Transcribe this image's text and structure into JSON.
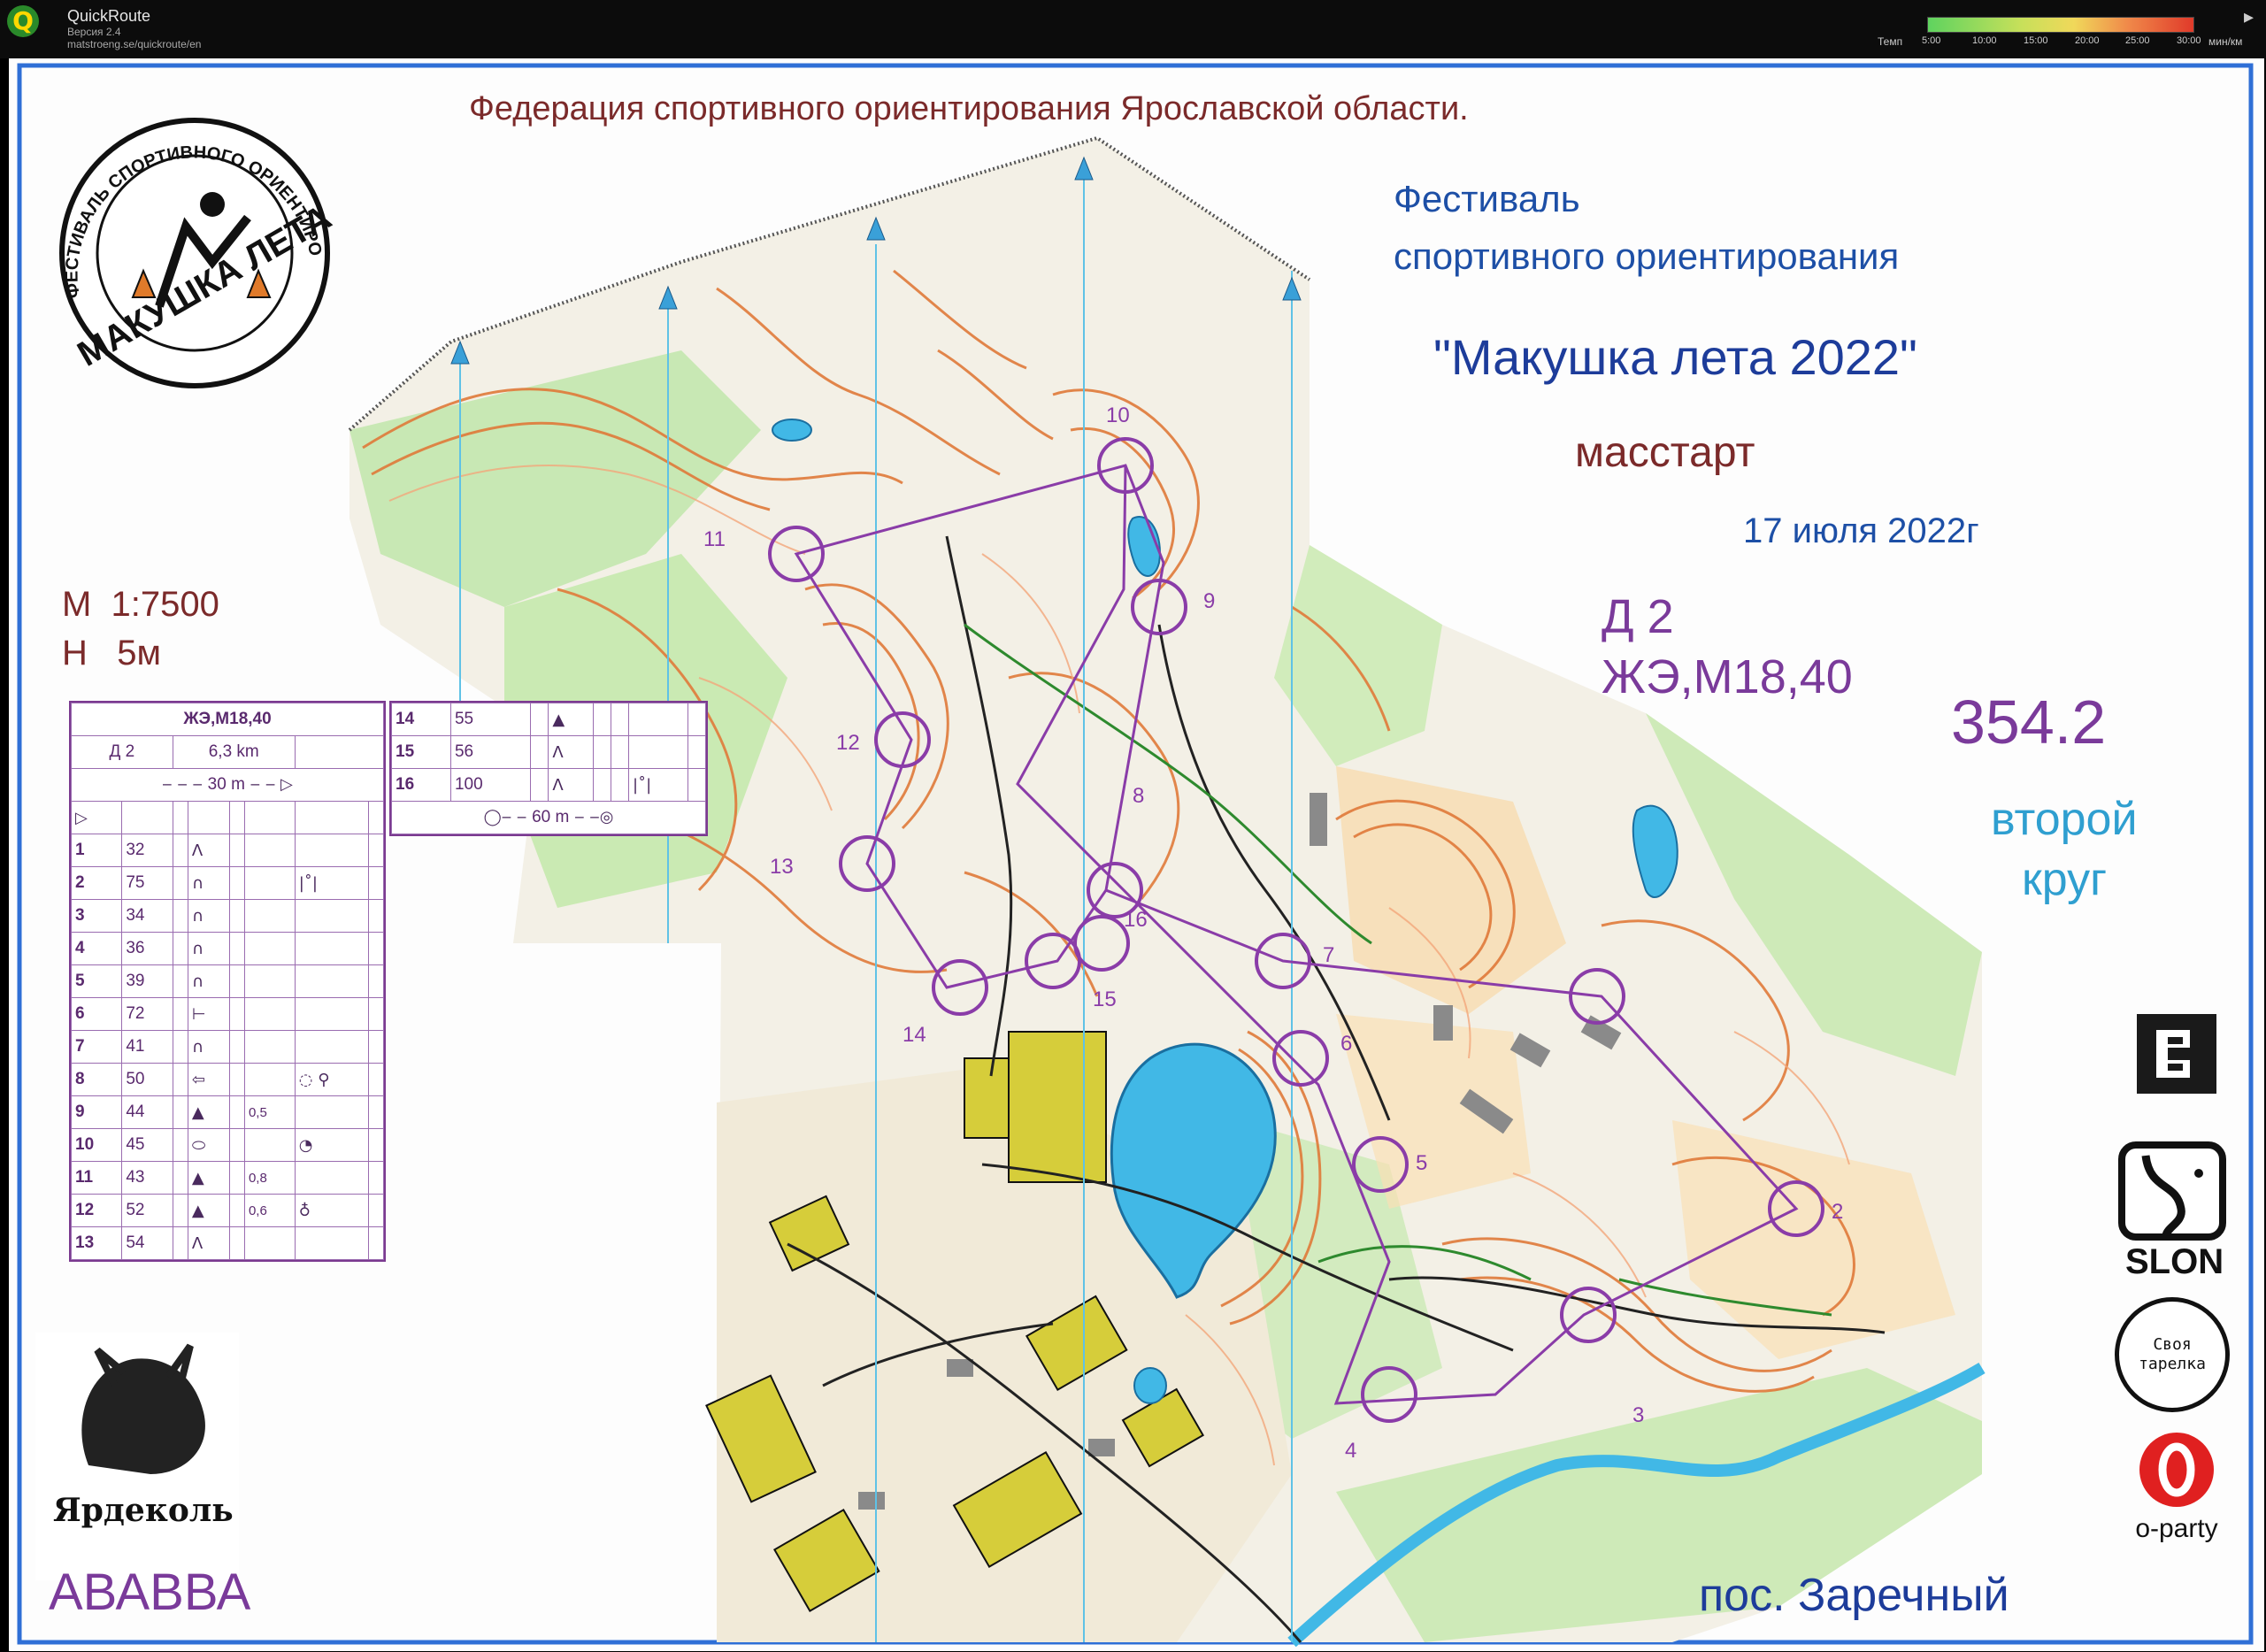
{
  "window": {
    "app_name": "QuickRoute",
    "version": "Версия 2.4",
    "url": "matstroeng.se/quickroute/en",
    "pace_legend": {
      "label": "Темп",
      "ticks": [
        "5:00",
        "10:00",
        "15:00",
        "20:00",
        "25:00",
        "30:00"
      ],
      "unit": "мин/км"
    }
  },
  "map": {
    "federation": "Федерация спортивного ориентирования Ярославской области.",
    "festival_line1": "Фестиваль",
    "festival_line2": "спортивного ориентирования",
    "event_title": "\"Макушка лета 2022\"",
    "race_format": "масстарт",
    "date": "17 июля 2022г",
    "scale": "М  1:7500",
    "contour": "Н   5м",
    "course_code": "Д 2",
    "course_classes": "ЖЭ,М18,40",
    "course_number": "354.2",
    "lap_line1": "второй",
    "lap_line2": "круг",
    "place": "пос. Заречный",
    "runner": "АВАВВА",
    "logo_top_text": "ФЕСТИВАЛЬ СПОРТИВНОГО ОРИЕНТИРОВАНИЯ",
    "logo_bottom_text": "МАКУШКА ЛЕТА",
    "sponsor_yardkol": "Ярдеколь",
    "sponsor_slon": "SLON",
    "sponsor_tarelka": "Своя тарелка",
    "sponsor_oparty": "o-party"
  },
  "control_description": {
    "header_classes": "ЖЭ,М18,40",
    "course": "Д 2",
    "length": "6,3 km",
    "start_marked": "30 m",
    "finish_marked": "60 m",
    "controls": [
      {
        "n": "1",
        "code": "32",
        "feature": "Λ",
        "extra": "",
        "extra2": ""
      },
      {
        "n": "2",
        "code": "75",
        "feature": "∩",
        "extra": "",
        "extra2": "|˚|"
      },
      {
        "n": "3",
        "code": "34",
        "feature": "∩",
        "extra": "",
        "extra2": ""
      },
      {
        "n": "4",
        "code": "36",
        "feature": "∩",
        "extra": "",
        "extra2": ""
      },
      {
        "n": "5",
        "code": "39",
        "feature": "∩",
        "extra": "",
        "extra2": ""
      },
      {
        "n": "6",
        "code": "72",
        "feature": "⊢",
        "extra": "",
        "extra2": ""
      },
      {
        "n": "7",
        "code": "41",
        "feature": "∩",
        "extra": "",
        "extra2": ""
      },
      {
        "n": "8",
        "code": "50",
        "feature": "⇦",
        "extra": "",
        "extra2": "◌  ⚲"
      },
      {
        "n": "9",
        "code": "44",
        "feature": "▲",
        "extra": "0,5",
        "extra2": ""
      },
      {
        "n": "10",
        "code": "45",
        "feature": "⬭",
        "extra": "",
        "extra2": "◔"
      },
      {
        "n": "11",
        "code": "43",
        "feature": "▲",
        "extra": "0,8",
        "extra2": ""
      },
      {
        "n": "12",
        "code": "52",
        "feature": "▲",
        "extra": "0,6",
        "extra2": "♁"
      },
      {
        "n": "13",
        "code": "54",
        "feature": "Λ",
        "extra": "",
        "extra2": ""
      }
    ],
    "controls_right": [
      {
        "n": "14",
        "code": "55",
        "feature": "▲",
        "extra2": ""
      },
      {
        "n": "15",
        "code": "56",
        "feature": "Λ",
        "extra2": ""
      },
      {
        "n": "16",
        "code": "100",
        "feature": "Λ",
        "extra2": "|˚|"
      }
    ]
  },
  "control_labels": [
    "2",
    "3",
    "4",
    "5",
    "6",
    "7",
    "8",
    "9",
    "10",
    "11",
    "12",
    "13",
    "14",
    "15",
    "16"
  ]
}
